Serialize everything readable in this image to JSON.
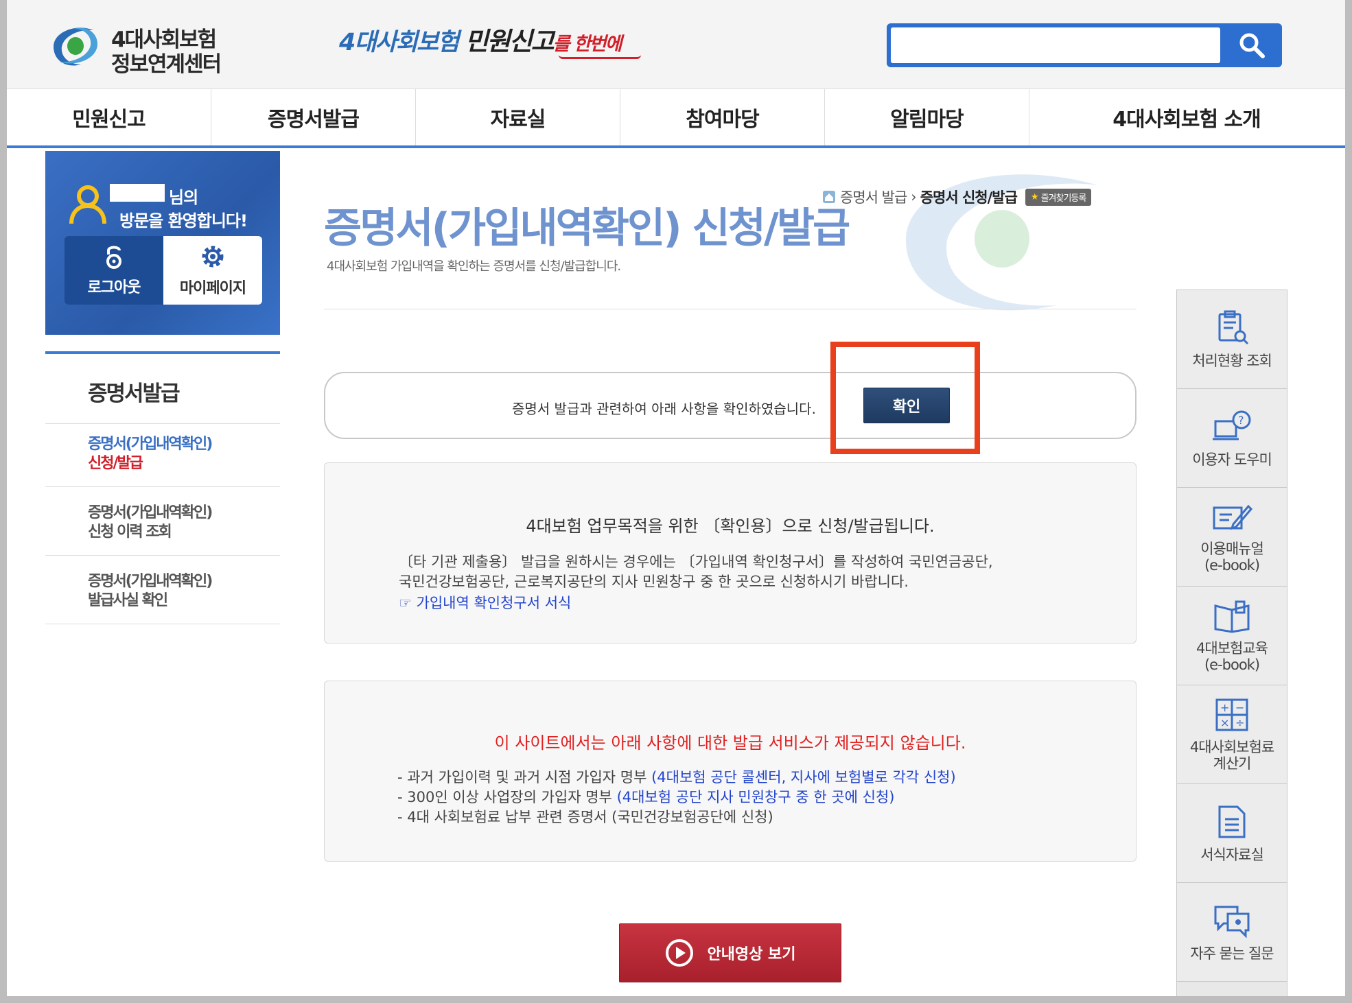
{
  "header": {
    "logo_line1": "4대사회보험",
    "logo_line2": "정보연계센터",
    "slogan_part1": "4대사회보험 ",
    "slogan_part2": "민원신고",
    "slogan_part3": "를 한번에",
    "search_placeholder": "",
    "search_icon": "search-icon"
  },
  "nav": {
    "items": [
      "민원신고",
      "증명서발급",
      "자료실",
      "참여마당",
      "알림마당",
      "4대사회보험 소개"
    ]
  },
  "welcome": {
    "suffix": "님의",
    "message": "방문을 환영합니다!",
    "logout_label": "로그아웃",
    "mypage_label": "마이페이지"
  },
  "sidebar": {
    "title": "증명서발급",
    "items": [
      {
        "line1": "증명서(가입내역확인)",
        "line2": "신청/발급",
        "active": true
      },
      {
        "line1": "증명서(가입내역확인)",
        "line2": "신청 이력 조회",
        "active": false
      },
      {
        "line1": "증명서(가입내역확인)",
        "line2": "발급사실 확인",
        "active": false
      }
    ]
  },
  "breadcrumb": {
    "parent": "증명서 발급",
    "current": "증명서 신청/발급",
    "favorite_label": "즐겨찾기등록"
  },
  "page": {
    "title": "증명서(가입내역확인) 신청/발급",
    "subtitle": "4대사회보험 가입내역을 확인하는 증명서를 신청/발급합니다."
  },
  "confirm": {
    "text": "증명서 발급과 관련하여 아래 사항을 확인하였습니다.",
    "button_label": "확인"
  },
  "notice1": {
    "heading": "4대보험 업무목적을 위한 〔확인용〕으로 신청/발급됩니다.",
    "line1": "〔타 기관 제출용〕 발급을 원하시는 경우에는 〔가입내역 확인청구서〕를 작성하여 국민연금공단,",
    "line2": "국민건강보험공단, 근로복지공단의 지사 민원창구 중 한 곳으로 신청하시기 바랍니다.",
    "link": "☞ 가입내역 확인청구서 서식"
  },
  "notice2": {
    "heading": "이 사이트에서는 아래 사항에 대한 발급 서비스가 제공되지 않습니다.",
    "items": [
      {
        "text": "- 과거 가입이력 및 과거 시점 가입자 명부 ",
        "note": "(4대보험 공단 콜센터, 지사에 보험별로 각각 신청)"
      },
      {
        "text": "- 300인 이상 사업장의 가입자 명부 ",
        "note": "(4대보험 공단 지사 민원창구 중 한 곳에 신청)"
      },
      {
        "text": "- 4대 사회보험료 납부 관련 증명서 (국민건강보험공단에 신청)",
        "note": ""
      }
    ]
  },
  "video_button": "안내영상 보기",
  "quick_menu": [
    {
      "label": "처리현황 조회",
      "icon": "clipboard-search-icon"
    },
    {
      "label": "이용자 도우미",
      "icon": "help-laptop-icon"
    },
    {
      "label": "이용매뉴얼\n(e-book)",
      "icon": "manual-edit-icon"
    },
    {
      "label": "4대보험교육\n(e-book)",
      "icon": "book-icon"
    },
    {
      "label": "4대사회보험료\n계산기",
      "icon": "calculator-icon"
    },
    {
      "label": "서식자료실",
      "icon": "document-icon"
    },
    {
      "label": "자주 묻는 질문",
      "icon": "chat-bubble-icon"
    }
  ],
  "colors": {
    "brand_blue": "#2d6fd0",
    "title_blue": "#6f93cf",
    "highlight_red": "#e8401c",
    "video_red": "#b52a35"
  }
}
